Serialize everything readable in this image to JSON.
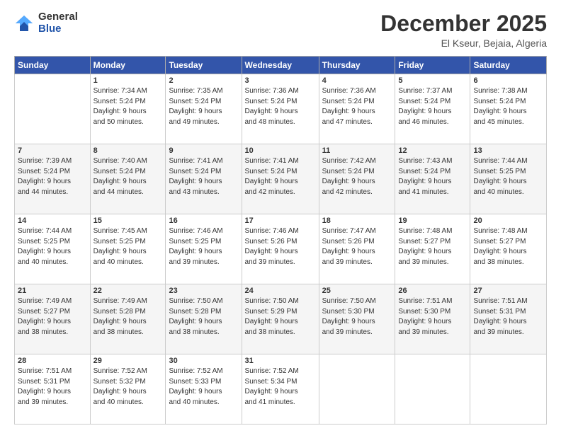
{
  "header": {
    "logo_general": "General",
    "logo_blue": "Blue",
    "month_title": "December 2025",
    "location": "El Kseur, Bejaia, Algeria"
  },
  "weekdays": [
    "Sunday",
    "Monday",
    "Tuesday",
    "Wednesday",
    "Thursday",
    "Friday",
    "Saturday"
  ],
  "weeks": [
    [
      {
        "day": "",
        "info": ""
      },
      {
        "day": "1",
        "info": "Sunrise: 7:34 AM\nSunset: 5:24 PM\nDaylight: 9 hours\nand 50 minutes."
      },
      {
        "day": "2",
        "info": "Sunrise: 7:35 AM\nSunset: 5:24 PM\nDaylight: 9 hours\nand 49 minutes."
      },
      {
        "day": "3",
        "info": "Sunrise: 7:36 AM\nSunset: 5:24 PM\nDaylight: 9 hours\nand 48 minutes."
      },
      {
        "day": "4",
        "info": "Sunrise: 7:36 AM\nSunset: 5:24 PM\nDaylight: 9 hours\nand 47 minutes."
      },
      {
        "day": "5",
        "info": "Sunrise: 7:37 AM\nSunset: 5:24 PM\nDaylight: 9 hours\nand 46 minutes."
      },
      {
        "day": "6",
        "info": "Sunrise: 7:38 AM\nSunset: 5:24 PM\nDaylight: 9 hours\nand 45 minutes."
      }
    ],
    [
      {
        "day": "7",
        "info": "Sunrise: 7:39 AM\nSunset: 5:24 PM\nDaylight: 9 hours\nand 44 minutes."
      },
      {
        "day": "8",
        "info": "Sunrise: 7:40 AM\nSunset: 5:24 PM\nDaylight: 9 hours\nand 44 minutes."
      },
      {
        "day": "9",
        "info": "Sunrise: 7:41 AM\nSunset: 5:24 PM\nDaylight: 9 hours\nand 43 minutes."
      },
      {
        "day": "10",
        "info": "Sunrise: 7:41 AM\nSunset: 5:24 PM\nDaylight: 9 hours\nand 42 minutes."
      },
      {
        "day": "11",
        "info": "Sunrise: 7:42 AM\nSunset: 5:24 PM\nDaylight: 9 hours\nand 42 minutes."
      },
      {
        "day": "12",
        "info": "Sunrise: 7:43 AM\nSunset: 5:24 PM\nDaylight: 9 hours\nand 41 minutes."
      },
      {
        "day": "13",
        "info": "Sunrise: 7:44 AM\nSunset: 5:25 PM\nDaylight: 9 hours\nand 40 minutes."
      }
    ],
    [
      {
        "day": "14",
        "info": "Sunrise: 7:44 AM\nSunset: 5:25 PM\nDaylight: 9 hours\nand 40 minutes."
      },
      {
        "day": "15",
        "info": "Sunrise: 7:45 AM\nSunset: 5:25 PM\nDaylight: 9 hours\nand 40 minutes."
      },
      {
        "day": "16",
        "info": "Sunrise: 7:46 AM\nSunset: 5:25 PM\nDaylight: 9 hours\nand 39 minutes."
      },
      {
        "day": "17",
        "info": "Sunrise: 7:46 AM\nSunset: 5:26 PM\nDaylight: 9 hours\nand 39 minutes."
      },
      {
        "day": "18",
        "info": "Sunrise: 7:47 AM\nSunset: 5:26 PM\nDaylight: 9 hours\nand 39 minutes."
      },
      {
        "day": "19",
        "info": "Sunrise: 7:48 AM\nSunset: 5:27 PM\nDaylight: 9 hours\nand 39 minutes."
      },
      {
        "day": "20",
        "info": "Sunrise: 7:48 AM\nSunset: 5:27 PM\nDaylight: 9 hours\nand 38 minutes."
      }
    ],
    [
      {
        "day": "21",
        "info": "Sunrise: 7:49 AM\nSunset: 5:27 PM\nDaylight: 9 hours\nand 38 minutes."
      },
      {
        "day": "22",
        "info": "Sunrise: 7:49 AM\nSunset: 5:28 PM\nDaylight: 9 hours\nand 38 minutes."
      },
      {
        "day": "23",
        "info": "Sunrise: 7:50 AM\nSunset: 5:28 PM\nDaylight: 9 hours\nand 38 minutes."
      },
      {
        "day": "24",
        "info": "Sunrise: 7:50 AM\nSunset: 5:29 PM\nDaylight: 9 hours\nand 38 minutes."
      },
      {
        "day": "25",
        "info": "Sunrise: 7:50 AM\nSunset: 5:30 PM\nDaylight: 9 hours\nand 39 minutes."
      },
      {
        "day": "26",
        "info": "Sunrise: 7:51 AM\nSunset: 5:30 PM\nDaylight: 9 hours\nand 39 minutes."
      },
      {
        "day": "27",
        "info": "Sunrise: 7:51 AM\nSunset: 5:31 PM\nDaylight: 9 hours\nand 39 minutes."
      }
    ],
    [
      {
        "day": "28",
        "info": "Sunrise: 7:51 AM\nSunset: 5:31 PM\nDaylight: 9 hours\nand 39 minutes."
      },
      {
        "day": "29",
        "info": "Sunrise: 7:52 AM\nSunset: 5:32 PM\nDaylight: 9 hours\nand 40 minutes."
      },
      {
        "day": "30",
        "info": "Sunrise: 7:52 AM\nSunset: 5:33 PM\nDaylight: 9 hours\nand 40 minutes."
      },
      {
        "day": "31",
        "info": "Sunrise: 7:52 AM\nSunset: 5:34 PM\nDaylight: 9 hours\nand 41 minutes."
      },
      {
        "day": "",
        "info": ""
      },
      {
        "day": "",
        "info": ""
      },
      {
        "day": "",
        "info": ""
      }
    ]
  ]
}
